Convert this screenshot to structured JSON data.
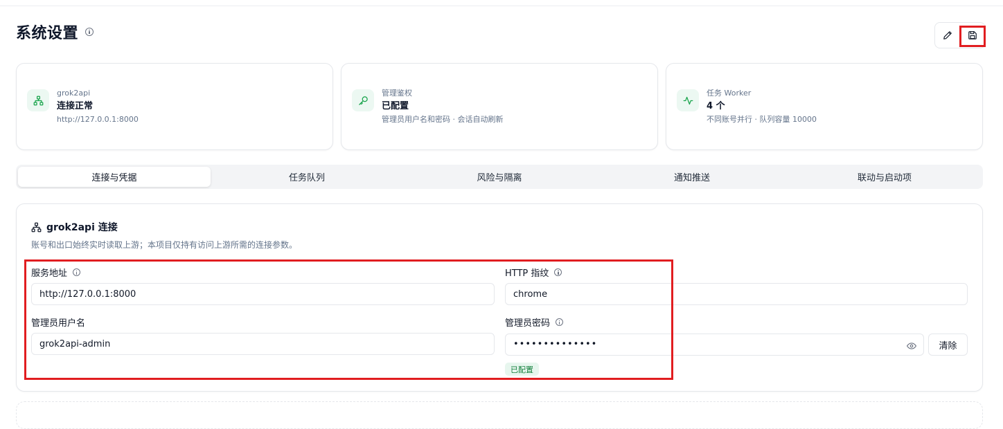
{
  "page": {
    "title": "系统设置"
  },
  "toolbar": {
    "edit_icon": "pencil-icon",
    "save_icon": "save-icon"
  },
  "stats": [
    {
      "icon": "network-icon",
      "label": "grok2api",
      "value": "连接正常",
      "sub": "http://127.0.0.1:8000"
    },
    {
      "icon": "key-icon",
      "label": "管理鉴权",
      "value": "已配置",
      "sub": "管理员用户名和密码 · 会话自动刷新"
    },
    {
      "icon": "activity-icon",
      "label": "任务 Worker",
      "value": "4 个",
      "sub": "不同账号并行 · 队列容量 10000"
    }
  ],
  "tabs": [
    "连接与凭据",
    "任务队列",
    "风险与隔离",
    "通知推送",
    "联动与启动项"
  ],
  "active_tab": 0,
  "section": {
    "title": "grok2api 连接",
    "description": "账号和出口始终实时读取上游；本项目仅持有访问上游所需的连接参数。",
    "fields": {
      "service_url": {
        "label": "服务地址",
        "value": "http://127.0.0.1:8000"
      },
      "http_fingerprint": {
        "label": "HTTP 指纹",
        "value": "chrome"
      },
      "admin_username": {
        "label": "管理员用户名",
        "value": "grok2api-admin"
      },
      "admin_password": {
        "label": "管理员密码",
        "value": "••••••••••••••",
        "clear_label": "清除",
        "status_badge": "已配置"
      }
    }
  },
  "colors": {
    "accent": "#16a34a",
    "accent_bg": "#ecf8f2",
    "highlight": "#e11d20"
  }
}
